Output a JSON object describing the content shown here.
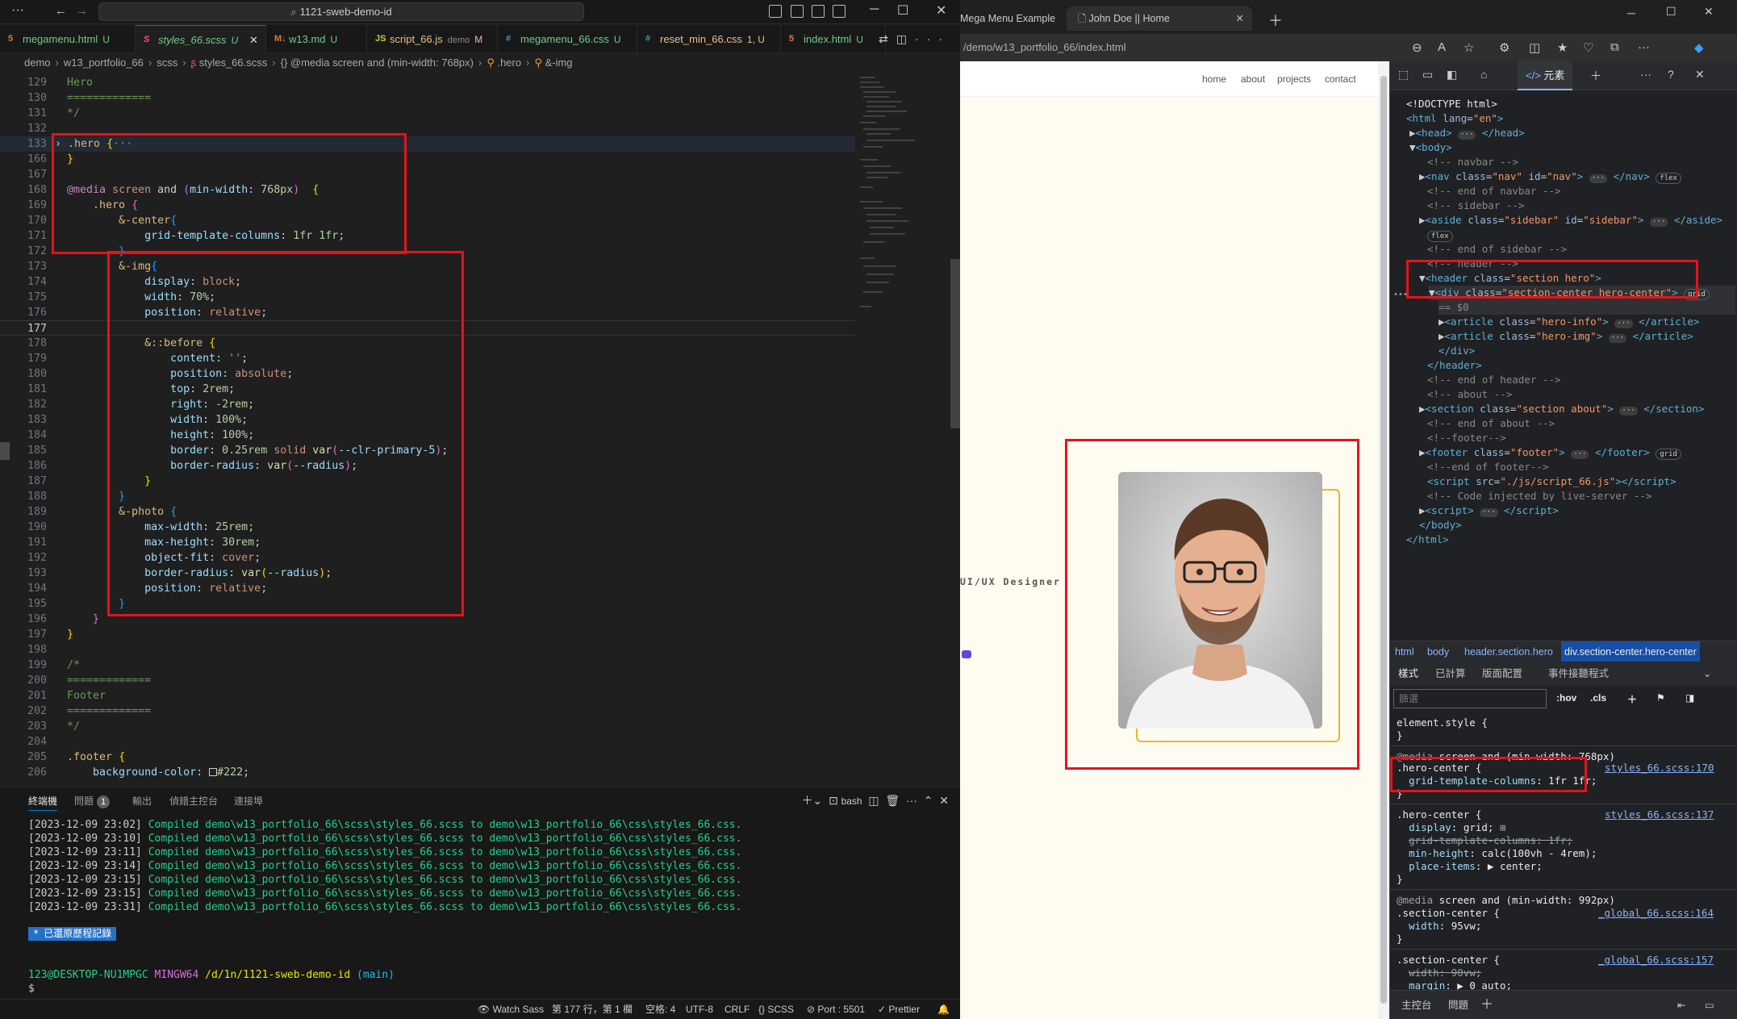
{
  "vscode": {
    "search_text": "1121-sweb-demo-id",
    "tabs": [
      {
        "name": "megamenu.html",
        "status": "U",
        "icon": "html-icon",
        "color": "#e37933"
      },
      {
        "name": "styles_66.scss",
        "status": "U",
        "icon": "sass-icon",
        "color": "#f55385",
        "active": true
      },
      {
        "name": "w13.md",
        "status": "U",
        "icon": "markdown-icon",
        "color": "#519aba"
      },
      {
        "name": "script_66.js",
        "extra": "demo",
        "status": "M",
        "icon": "js-icon",
        "color": "#cbcb41"
      },
      {
        "name": "megamenu_66.css",
        "status": "U",
        "icon": "css-icon",
        "color": "#519aba"
      },
      {
        "name": "reset_min_66.css",
        "status": "1, U",
        "icon": "css-icon",
        "color": "#519aba"
      },
      {
        "name": "index.html",
        "status": "U",
        "icon": "html-icon",
        "color": "#e37933"
      }
    ],
    "breadcrumb": [
      "demo",
      "w13_portfolio_66",
      "scss",
      "styles_66.scss",
      "{} @media screen and (min-width: 768px)",
      ".hero",
      "&-img"
    ],
    "panel": {
      "tabs": [
        "終端機",
        "問題",
        "輸出",
        "偵錯主控台",
        "連接埠"
      ],
      "problems_count": "1",
      "shell": "bash",
      "terminal_lines": [
        {
          "time": "[2023-12-09 23:02]",
          "text": "Compiled demo\\w13_portfolio_66\\scss\\styles_66.scss to demo\\w13_portfolio_66\\css\\styles_66.css."
        },
        {
          "time": "[2023-12-09 23:10]",
          "text": "Compiled demo\\w13_portfolio_66\\scss\\styles_66.scss to demo\\w13_portfolio_66\\css\\styles_66.css."
        },
        {
          "time": "[2023-12-09 23:11]",
          "text": "Compiled demo\\w13_portfolio_66\\scss\\styles_66.scss to demo\\w13_portfolio_66\\css\\styles_66.css."
        },
        {
          "time": "[2023-12-09 23:14]",
          "text": "Compiled demo\\w13_portfolio_66\\scss\\styles_66.scss to demo\\w13_portfolio_66\\css\\styles_66.css."
        },
        {
          "time": "[2023-12-09 23:15]",
          "text": "Compiled demo\\w13_portfolio_66\\scss\\styles_66.scss to demo\\w13_portfolio_66\\css\\styles_66.css."
        },
        {
          "time": "[2023-12-09 23:15]",
          "text": "Compiled demo\\w13_portfolio_66\\scss\\styles_66.scss to demo\\w13_portfolio_66\\css\\styles_66.css."
        },
        {
          "time": "[2023-12-09 23:31]",
          "text": "Compiled demo\\w13_portfolio_66\\scss\\styles_66.scss to demo\\w13_portfolio_66\\css\\styles_66.css."
        }
      ],
      "restored_label": "已還原歷程記錄",
      "prompt_user": "123@DESKTOP-NU1MPGC",
      "prompt_shell": "MINGW64",
      "prompt_path": "/d/1n/1121-sweb-demo-id",
      "prompt_branch": "(main)",
      "prompt_char": "$"
    },
    "status": {
      "watch": "Watch Sass",
      "position": "第 177 行，第 1 欄",
      "spaces": "空格: 4",
      "encoding": "UTF-8",
      "eol": "CRLF",
      "lang": "SCSS",
      "port": "Port : 5501",
      "prettier": "Prettier"
    }
  },
  "browser": {
    "tabs": [
      {
        "title": "Mega Menu Example"
      },
      {
        "title": "John Doe || Home",
        "active": true
      }
    ],
    "url": "/demo/w13_portfolio_66/index.html",
    "page": {
      "nav": [
        "home",
        "about",
        "projects",
        "contact"
      ],
      "role": "UI/UX Designer"
    },
    "devtools": {
      "elements_tab": "元素",
      "crumbs": [
        "html",
        "body",
        "header.section.hero",
        "div.section-center.hero-center"
      ],
      "subtabs": [
        "樣式",
        "已計算",
        "版面配置",
        "事件接聽程式"
      ],
      "filter_placeholder": "篩選",
      "hov": ":hov",
      "cls": ".cls",
      "drawer": [
        "主控台",
        "問題"
      ],
      "tree_eq": "== $0"
    }
  }
}
